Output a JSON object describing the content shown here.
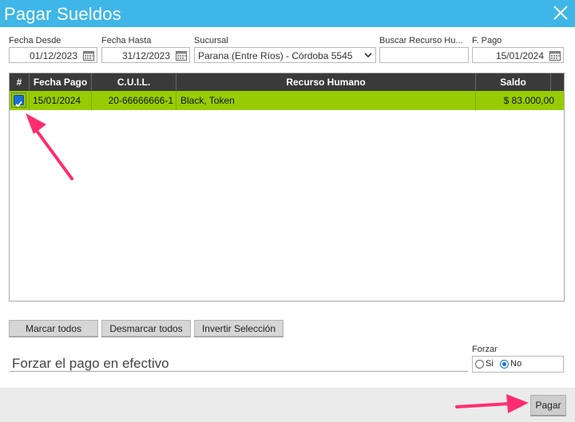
{
  "window": {
    "title": "Pagar Sueldos"
  },
  "filters": {
    "fecha_desde": {
      "label": "Fecha Desde",
      "value": "01/12/2023"
    },
    "fecha_hasta": {
      "label": "Fecha Hasta",
      "value": "31/12/2023"
    },
    "sucursal": {
      "label": "Sucursal",
      "value": "Parana (Entre Ríos) - Córdoba 5545"
    },
    "buscar": {
      "label": "Buscar Recurso Hu...",
      "value": ""
    },
    "fecha_pago": {
      "label": "F. Pago",
      "value": "15/01/2024"
    }
  },
  "grid": {
    "columns": [
      "#",
      "Fecha Pago",
      "C.U.I.L.",
      "Recurso Humano",
      "Saldo"
    ],
    "rows": [
      {
        "checked": true,
        "fecha_pago": "15/01/2024",
        "cuil": "20-66666666-1",
        "recurso": "Black, Token",
        "saldo": "$ 83.000,00"
      }
    ]
  },
  "actions": {
    "marcar": "Marcar todos",
    "desmarcar": "Desmarcar todos",
    "invertir": "Invertir Selección"
  },
  "forzar": {
    "field_placeholder": "Forzar el pago en efectivo",
    "label": "Forzar",
    "options": [
      "Si",
      "No"
    ],
    "selected": "No"
  },
  "footer": {
    "pagar": "Pagar"
  },
  "colors": {
    "titlebar": "#3fb6e8",
    "selected_row": "#97cc04",
    "header": "#3a3a3a",
    "annotation_arrow": "#ff2d6f"
  }
}
